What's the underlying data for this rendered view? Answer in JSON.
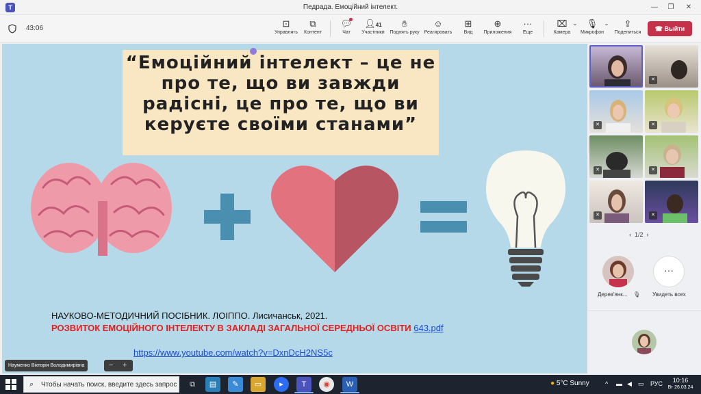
{
  "window": {
    "title": "Педрада. Емоційний інтелект."
  },
  "toolbar": {
    "timer": "43:06",
    "buttons": {
      "manage": "Управлять",
      "content": "Контент",
      "chat": "Чат",
      "participants": "Участники",
      "participants_count": "41",
      "raise_hand": "Поднять руку",
      "react": "Реагировать",
      "view": "Вид",
      "apps": "Приложения",
      "more": "Еще",
      "camera": "Камера",
      "mic": "Микрофон",
      "share": "Поделиться"
    },
    "leave": "Выйти"
  },
  "slide": {
    "quote": "“Емоційний інтелект – це не про те, що ви завжди радісні, це про те, що ви керуєте своїми станами”",
    "citation": "НАУКОВО-МЕТОДИЧНИЙ ПОСІБНИК. ЛОІППО. Лисичанськ, 2021.",
    "subtitle": "РОЗВИТОК ЕМОЦІЙНОГО ІНТЕЛЕКТУ В ЗАКЛАДІ ЗАГАЛЬНОЇ СЕРЕДНЬОЇ ОСВІТИ",
    "pdf_link": "643.pdf",
    "youtube_link": "https://www.youtube.com/watch?v=DxnDcH2NS5c",
    "presenter": "Науменко Вікторія Володимирівна",
    "zoom_minus": "−",
    "zoom_plus": "+"
  },
  "panel": {
    "pager": "1/2",
    "participant_name": "Дерев'янк...",
    "see_all": "Увидеть всех"
  },
  "taskbar": {
    "search_placeholder": "Чтобы начать поиск, введите здесь запрос",
    "weather": "5°C  Sunny",
    "lang": "РУС",
    "time": "10:16",
    "date": "Вт 26.03.24"
  },
  "colors": {
    "slide_bg": "#b5d9e8",
    "quote_bg": "#f9e7c4",
    "brain": "#ee9aa9",
    "plus_equals": "#4a8eb0",
    "heart_left": "#e2737e",
    "heart_right": "#b85563",
    "leave_button": "#c4314b",
    "teams_accent": "#5b5fc7"
  }
}
